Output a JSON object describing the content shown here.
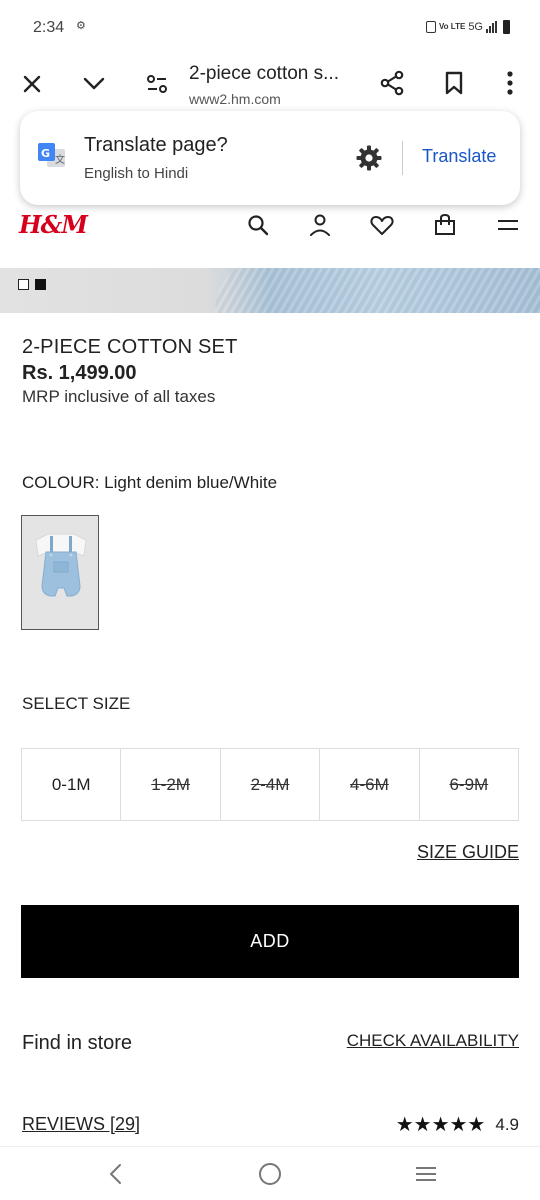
{
  "status_bar": {
    "time": "2:34",
    "network": "5G",
    "volte": "Vo LTE"
  },
  "browser": {
    "page_title": "2-piece cotton s...",
    "url": "www2.hm.com"
  },
  "translate_prompt": {
    "title": "Translate page?",
    "subtitle": "English to Hindi",
    "action_label": "Translate",
    "accent_color": "#1a56c8"
  },
  "store": {
    "brand": "H&M",
    "brand_color": "#d6001c"
  },
  "product": {
    "name": "2-PIECE COTTON SET",
    "price": "Rs. 1,499.00",
    "tax_note": "MRP inclusive of all taxes",
    "colour_line": "COLOUR: Light denim blue/White"
  },
  "sizes": {
    "heading": "SELECT SIZE",
    "options": [
      {
        "label": "0-1M",
        "available": true
      },
      {
        "label": "1-2M",
        "available": false
      },
      {
        "label": "2-4M",
        "available": false
      },
      {
        "label": "4-6M",
        "available": false
      },
      {
        "label": "6-9M",
        "available": false
      }
    ],
    "guide_label": "SIZE GUIDE"
  },
  "actions": {
    "add_label": "ADD",
    "find_store_label": "Find in store",
    "check_availability_label": "CHECK AVAILABILITY"
  },
  "reviews": {
    "label": "REVIEWS [29]",
    "stars": "★★★★★",
    "rating": "4.9"
  }
}
